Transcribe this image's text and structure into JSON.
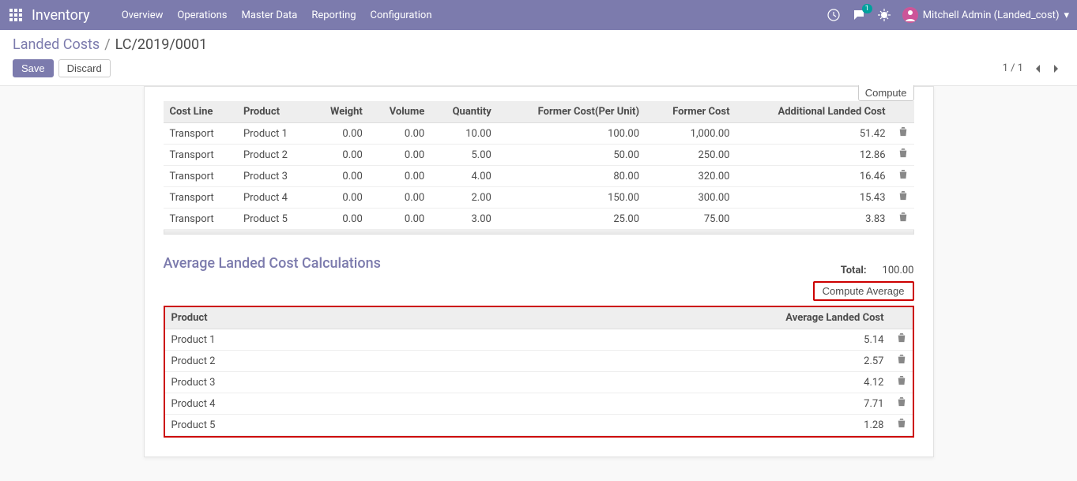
{
  "navbar": {
    "brand": "Inventory",
    "menu": [
      "Overview",
      "Operations",
      "Master Data",
      "Reporting",
      "Configuration"
    ],
    "messages_badge": "1",
    "user": "Mitchell Admin (Landed_cost)"
  },
  "breadcrumb": {
    "parent": "Landed Costs",
    "current": "LC/2019/0001"
  },
  "buttons": {
    "save": "Save",
    "discard": "Discard",
    "compute": "Compute",
    "compute_average": "Compute Average"
  },
  "pager": {
    "text": "1 / 1"
  },
  "table1": {
    "headers": {
      "cost_line": "Cost Line",
      "product": "Product",
      "weight": "Weight",
      "volume": "Volume",
      "quantity": "Quantity",
      "former_cost_unit": "Former Cost(Per Unit)",
      "former_cost": "Former Cost",
      "additional": "Additional Landed Cost"
    },
    "rows": [
      {
        "cost_line": "Transport",
        "product": "Product 1",
        "weight": "0.00",
        "volume": "0.00",
        "quantity": "10.00",
        "fcu": "100.00",
        "fc": "1,000.00",
        "alc": "51.42"
      },
      {
        "cost_line": "Transport",
        "product": "Product 2",
        "weight": "0.00",
        "volume": "0.00",
        "quantity": "5.00",
        "fcu": "50.00",
        "fc": "250.00",
        "alc": "12.86"
      },
      {
        "cost_line": "Transport",
        "product": "Product 3",
        "weight": "0.00",
        "volume": "0.00",
        "quantity": "4.00",
        "fcu": "80.00",
        "fc": "320.00",
        "alc": "16.46"
      },
      {
        "cost_line": "Transport",
        "product": "Product 4",
        "weight": "0.00",
        "volume": "0.00",
        "quantity": "2.00",
        "fcu": "150.00",
        "fc": "300.00",
        "alc": "15.43"
      },
      {
        "cost_line": "Transport",
        "product": "Product 5",
        "weight": "0.00",
        "volume": "0.00",
        "quantity": "3.00",
        "fcu": "25.00",
        "fc": "75.00",
        "alc": "3.83"
      }
    ]
  },
  "section_title": "Average Landed Cost Calculations",
  "total": {
    "label": "Total:",
    "value": "100.00"
  },
  "table2": {
    "headers": {
      "product": "Product",
      "avg": "Average Landed Cost"
    },
    "rows": [
      {
        "product": "Product 1",
        "avg": "5.14"
      },
      {
        "product": "Product 2",
        "avg": "2.57"
      },
      {
        "product": "Product 3",
        "avg": "4.12"
      },
      {
        "product": "Product 4",
        "avg": "7.71"
      },
      {
        "product": "Product 5",
        "avg": "1.28"
      }
    ]
  }
}
